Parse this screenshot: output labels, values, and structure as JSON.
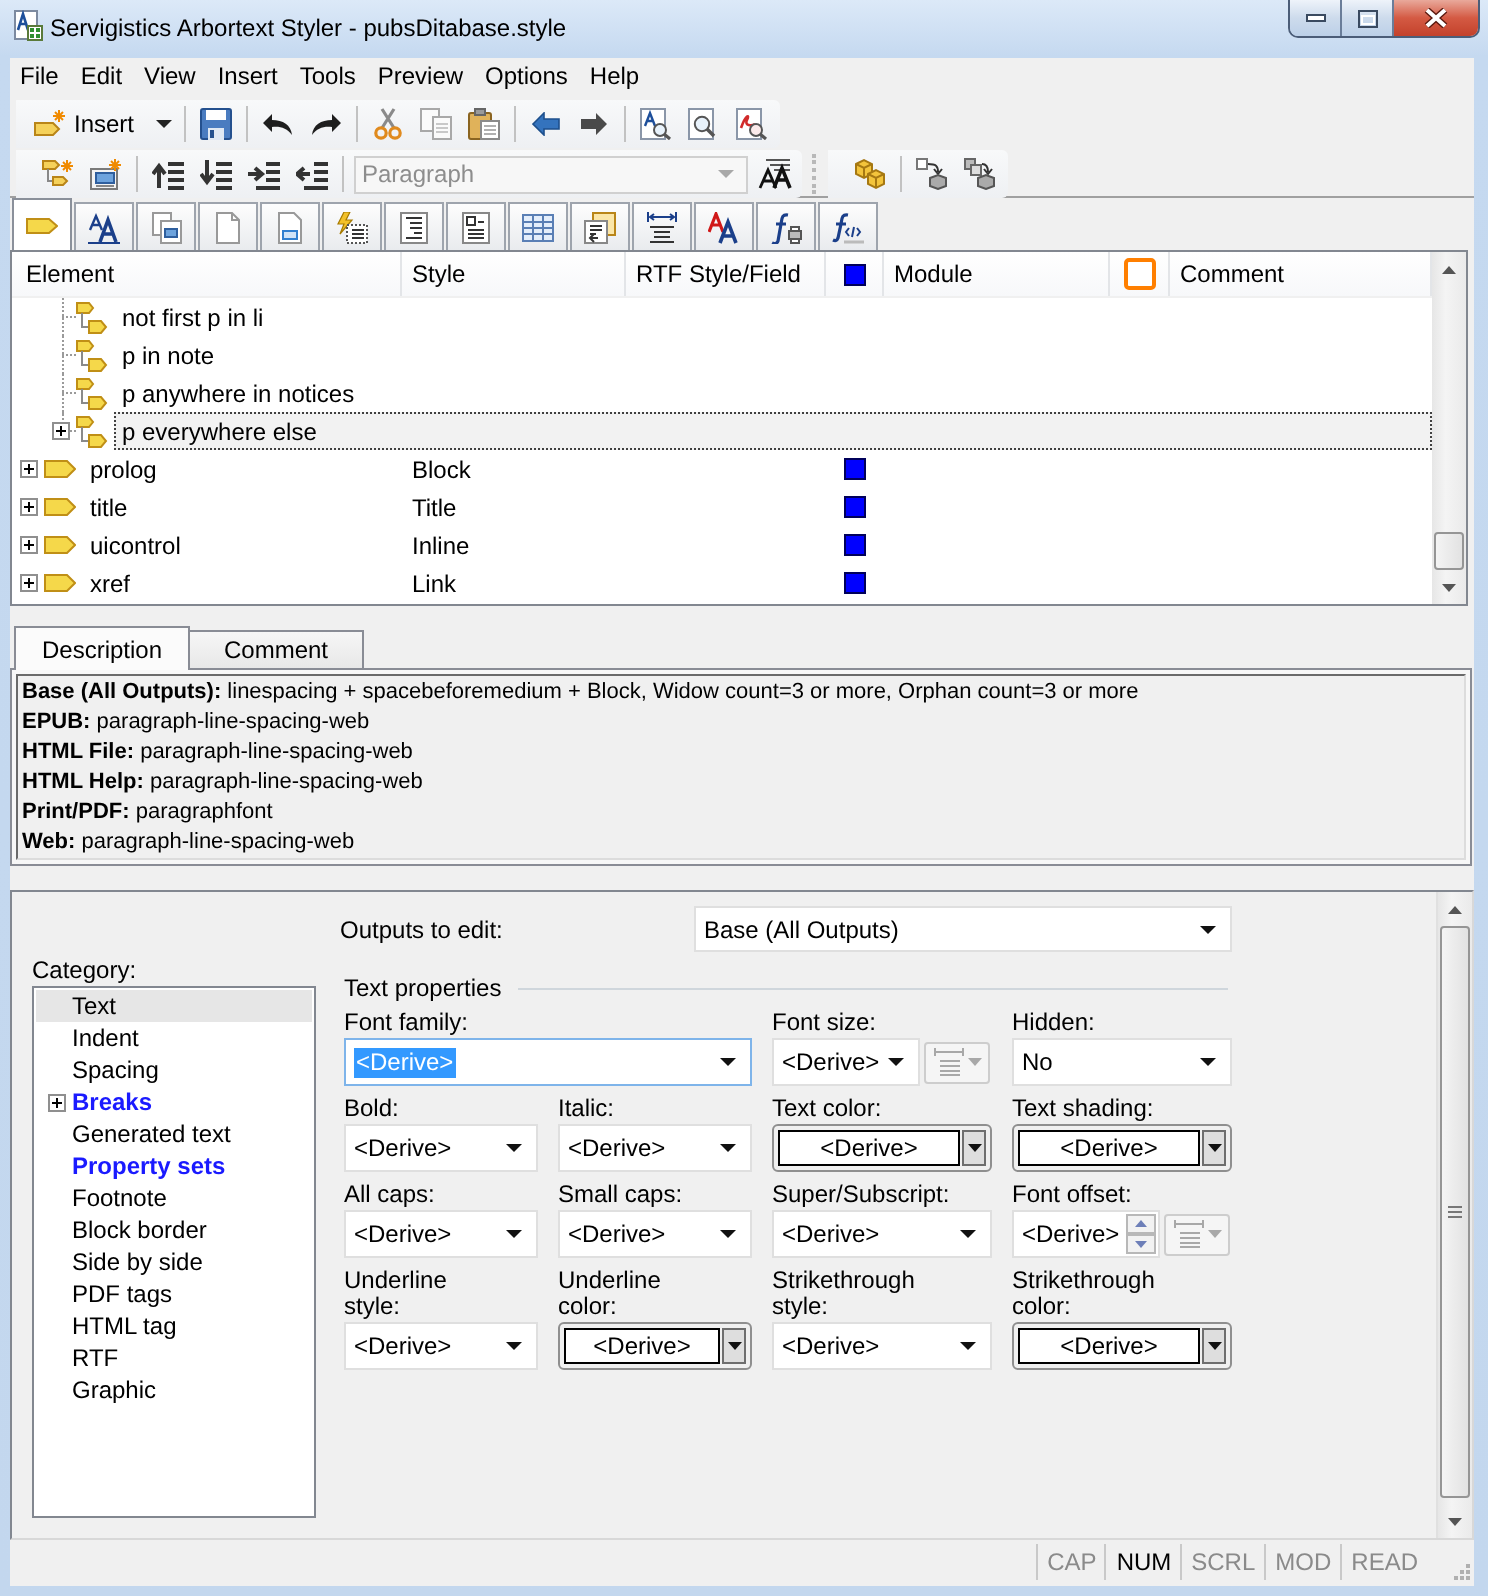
{
  "window": {
    "title": "Servigistics Arbortext Styler - pubsDitabase.style"
  },
  "menu": [
    "File",
    "Edit",
    "View",
    "Insert",
    "Tools",
    "Preview",
    "Options",
    "Help"
  ],
  "toolbar": {
    "insert_button": "Insert",
    "style_dropdown": {
      "value": "Paragraph",
      "disabled": true
    }
  },
  "icon_tabs": [
    {
      "selected": true
    },
    {
      "selected": false
    },
    {
      "selected": false
    },
    {
      "selected": false
    },
    {
      "selected": false
    },
    {
      "selected": false
    },
    {
      "selected": false
    },
    {
      "selected": false
    },
    {
      "selected": false
    },
    {
      "selected": false
    },
    {
      "selected": false
    },
    {
      "selected": false
    },
    {
      "selected": false
    },
    {
      "selected": false
    }
  ],
  "table": {
    "columns": [
      {
        "kind": "text",
        "label": "Element"
      },
      {
        "kind": "text",
        "label": "Style"
      },
      {
        "kind": "text",
        "label": "RTF Style/Field"
      },
      {
        "kind": "swatch",
        "color": "#0000ff"
      },
      {
        "kind": "text",
        "label": "Module"
      },
      {
        "kind": "frame",
        "color": "#ff7f00"
      },
      {
        "kind": "text",
        "label": "Comment"
      }
    ],
    "rows": [
      {
        "children": [
          {
            "element": "not first p in li",
            "selected": false,
            "marked": false
          },
          {
            "element": "p in note",
            "selected": false,
            "marked": false
          },
          {
            "element": "p anywhere in notices",
            "selected": false,
            "marked": false
          },
          {
            "element": "p everywhere else",
            "selected": true,
            "marked": false,
            "expanded": false
          }
        ]
      },
      {
        "element": "prolog",
        "style": "Block",
        "selected": false,
        "marked": true,
        "expanded": false
      },
      {
        "element": "title",
        "style": "Title",
        "selected": false,
        "marked": true,
        "expanded": false
      },
      {
        "element": "uicontrol",
        "style": "Inline",
        "selected": false,
        "marked": true,
        "expanded": false
      },
      {
        "element": "xref",
        "style": "Link",
        "selected": false,
        "marked": true,
        "expanded": false
      }
    ]
  },
  "description_tabs": [
    {
      "label": "Description",
      "selected": true
    },
    {
      "label": "Comment",
      "selected": false
    }
  ],
  "description_lines": [
    "**Base (All Outputs):** linespacing + spacebeforemedium + Block, Widow count=3 or more, Orphan count=3 or more",
    "**EPUB:** paragraph-line-spacing-web",
    "**HTML File:** paragraph-line-spacing-web",
    "**HTML Help:** paragraph-line-spacing-web",
    "**Print/PDF:** paragraphfont",
    "**Web:** paragraph-line-spacing-web"
  ],
  "properties": {
    "outputs": {
      "label": "Outputs to edit:",
      "value": "Base (All Outputs)"
    },
    "category": {
      "label": "Category:",
      "items": [
        {
          "label": "Text",
          "selected": true,
          "highlighted": false
        },
        {
          "label": "Indent",
          "selected": false,
          "highlighted": false
        },
        {
          "label": "Spacing",
          "selected": false,
          "highlighted": false
        },
        {
          "label": "Breaks",
          "selected": false,
          "highlighted": true,
          "expanded": false
        },
        {
          "label": "Generated text",
          "selected": false,
          "highlighted": false
        },
        {
          "label": "Property sets",
          "selected": false,
          "highlighted": true
        },
        {
          "label": "Footnote",
          "selected": false,
          "highlighted": false
        },
        {
          "label": "Block border",
          "selected": false,
          "highlighted": false
        },
        {
          "label": "Side by side",
          "selected": false,
          "highlighted": false
        },
        {
          "label": "PDF tags",
          "selected": false,
          "highlighted": false
        },
        {
          "label": "HTML tag",
          "selected": false,
          "highlighted": false
        },
        {
          "label": "RTF",
          "selected": false,
          "highlighted": false
        },
        {
          "label": "Graphic",
          "selected": false,
          "highlighted": false
        }
      ]
    },
    "group_title": "Text properties",
    "fields": [
      {
        "kind": "wide",
        "label": "Font family:",
        "value": "<Derive>",
        "focused": true
      },
      {
        "kind": "size",
        "label": "Font size:",
        "value": "<Derive>",
        "focused": false
      },
      {
        "kind": "combo",
        "label": "Hidden:",
        "value": "No",
        "focused": false
      },
      {
        "kind": "combo",
        "label": "Bold:",
        "value": "<Derive>",
        "focused": false
      },
      {
        "kind": "combo",
        "label": "Italic:",
        "value": "<Derive>",
        "focused": false
      },
      {
        "kind": "color",
        "label": "Text color:",
        "value": "<Derive>",
        "focused": false
      },
      {
        "kind": "color",
        "label": "Text shading:",
        "value": "<Derive>",
        "focused": false
      },
      {
        "kind": "combo",
        "label": "All caps:",
        "value": "<Derive>",
        "focused": false
      },
      {
        "kind": "combo",
        "label": "Small caps:",
        "value": "<Derive>",
        "focused": false
      },
      {
        "kind": "combo",
        "label": "Super/Subscript:",
        "value": "<Derive>",
        "focused": false
      },
      {
        "kind": "spin",
        "label": "Font offset:",
        "value": "<Derive>",
        "focused": false
      },
      {
        "kind": "combo",
        "label": "Underline\nstyle:",
        "value": "<Derive>",
        "focused": false
      },
      {
        "kind": "color",
        "label": "Underline\ncolor:",
        "value": "<Derive>",
        "focused": false
      },
      {
        "kind": "combo",
        "label": "Strikethrough\nstyle:",
        "value": "<Derive>",
        "focused": false
      },
      {
        "kind": "color",
        "label": "Strikethrough\ncolor:",
        "value": "<Derive>",
        "focused": false
      }
    ]
  },
  "status_bar": [
    {
      "label": "CAP",
      "on": false
    },
    {
      "label": "NUM",
      "on": true
    },
    {
      "label": "SCRL",
      "on": false
    },
    {
      "label": "MOD",
      "on": false
    },
    {
      "label": "READ",
      "on": false
    }
  ]
}
